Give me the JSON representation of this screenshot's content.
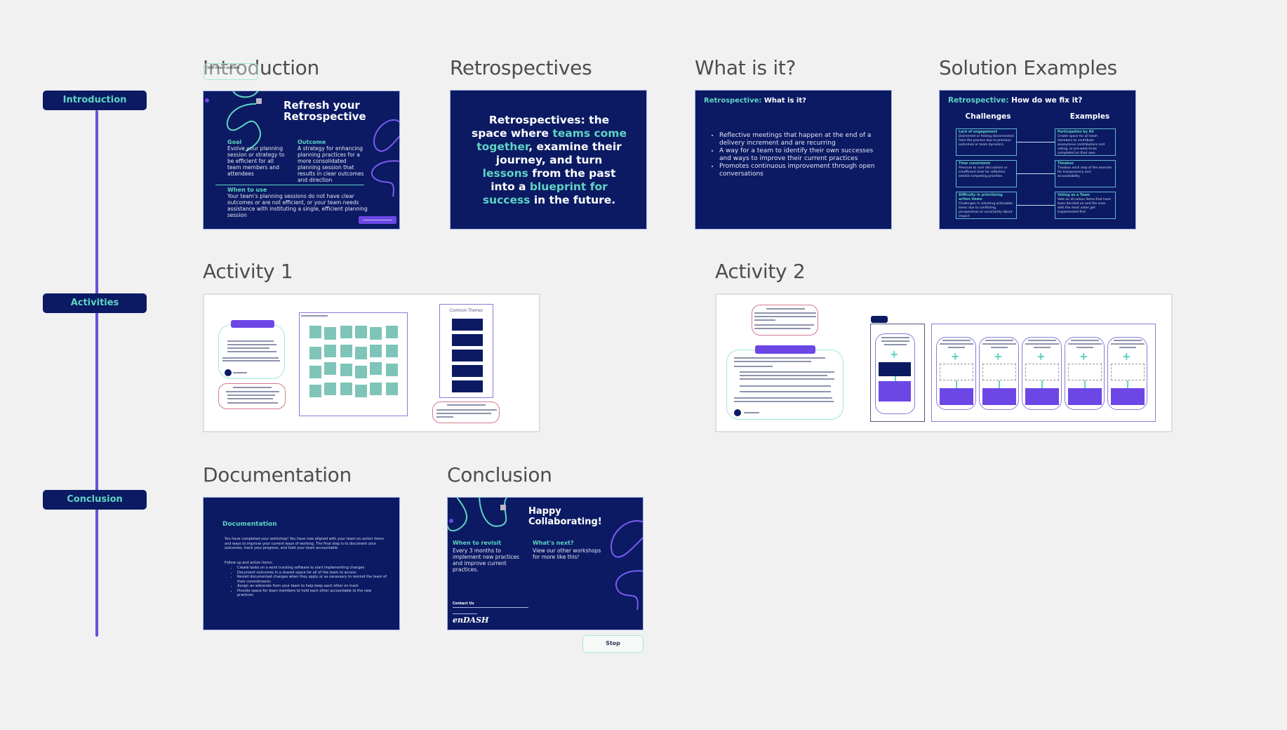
{
  "colors": {
    "canvas_bg": "#f1f1f1",
    "slide_bg": "#0b1a63",
    "accent_teal": "#5fd4c2",
    "accent_purple": "#6c47e6",
    "sticky_teal": "#7ec4b8"
  },
  "timeline": {
    "items": [
      {
        "label": "Introduction"
      },
      {
        "label": "Activities"
      },
      {
        "label": "Conclusion"
      }
    ]
  },
  "sections": {
    "introduction": {
      "title": "Introduction",
      "overlay_sticky": "Start timer / activities",
      "slide": {
        "heading": "Refresh your Retrospective",
        "goal_label": "Goal",
        "goal_text": "Evolve your planning session or strategy to be efficient for all team members and attendees",
        "outcome_label": "Outcome",
        "outcome_text": "A strategy for enhancing planning practices for a more consolidated planning session that results in clear outcomes and direction",
        "when_label": "When to use",
        "when_text": "Your team's planning sessions do not have clear outcomes or are not efficient, or your team needs assistance with instituting a single, efficient planning session"
      }
    },
    "retrospectives": {
      "title": "Retrospectives",
      "slide": {
        "parts": [
          {
            "text": "Retrospectives: the space where ",
            "accent": false
          },
          {
            "text": "teams come together",
            "accent": true
          },
          {
            "text": ", examine their journey, and turn ",
            "accent": false
          },
          {
            "text": "lessons",
            "accent": true
          },
          {
            "text": " from the past into a ",
            "accent": false
          },
          {
            "text": "blueprint for success",
            "accent": true
          },
          {
            "text": " in the future.",
            "accent": false
          }
        ]
      }
    },
    "what_is_it": {
      "title": "What is it?",
      "slide": {
        "heading_accent": "Retrospective:",
        "heading": "What is it?",
        "bullets": [
          "Reflective meetings that happen at the end of a delivery increment and are recurring",
          "A way for a team to identify their own successes and ways to improve their current practices",
          "Promotes continuous improvement through open conversations"
        ]
      }
    },
    "solution_examples": {
      "title": "Solution Examples",
      "slide": {
        "heading_accent": "Retrospective:",
        "heading": "How do we fix it?",
        "col_challenges": "Challenges",
        "col_examples": "Examples",
        "rows": [
          {
            "challenge_title": "Lack of engagement",
            "challenge_text": "Disinterest or feeling disconnected from the process due to previous outcomes or team dynamics",
            "example_title": "Participation by All",
            "example_text": "Create space for all team members to contribute anonymous contributions and voting, or pre-work to be completed on their own"
          },
          {
            "challenge_title": "Time constraints",
            "challenge_text": "Pressure to rush discussions or insufficient time for reflection amidst competing priorities",
            "example_title": "Timebox",
            "example_text": "Timebox each step of the exercise for transparency and accountability"
          },
          {
            "challenge_title": "Difficulty in prioritizing action items",
            "challenge_text": "Challenges in selecting actionable items due to conflicting perspectives or uncertainty about impact",
            "example_title": "Voting as a Team",
            "example_text": "Vote on all action items that have been decided on and the ones with the most votes get implemented first"
          }
        ]
      }
    },
    "activity1": {
      "title": "Activity 1",
      "themes_label": "Common Themes"
    },
    "activity2": {
      "title": "Activity 2"
    },
    "documentation": {
      "title": "Documentation",
      "slide": {
        "heading": "Documentation",
        "intro": "You have completed your workshop! You have now aligned with your team on action items and ways to improve your current ways of working. The final step is to document your outcomes, track your progress, and hold your team accountable.",
        "list_label": "Follow up and action items:",
        "items": [
          "Create tasks on a work tracking software to start implementing changes",
          "Document outcomes in a shared space for all of the team to access",
          "Revisit documented changes when they apply or as necessary to remind the team of their commitments",
          "Assign an advocate from your team to help keep each other on track",
          "Provide space for team members to hold each other accountable to the new practices"
        ]
      }
    },
    "conclusion": {
      "title": "Conclusion",
      "slide": {
        "heading": "Happy Collaborating!",
        "revisit_label": "When to revisit",
        "revisit_text": "Every 3 months to implement new practices and improve current practices.",
        "next_label": "What's next?",
        "next_text": "View our other workshops for more like this!",
        "contact_label": "Contact Us",
        "brand": "enDASH"
      },
      "stop_button": "Stop"
    }
  }
}
